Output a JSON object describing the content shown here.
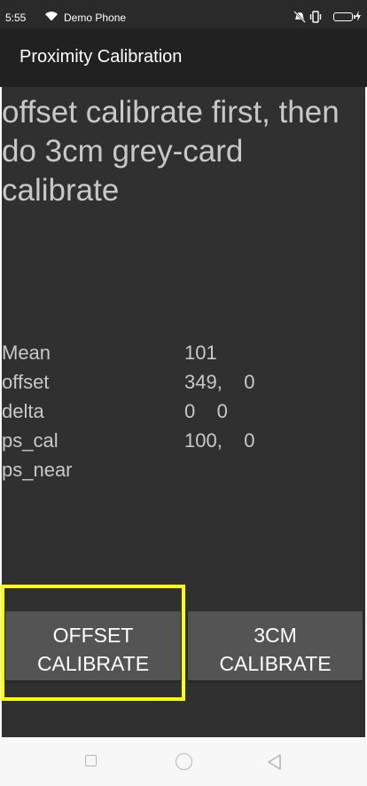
{
  "status_bar": {
    "time": "5:55",
    "carrier": "Demo Phone",
    "icons": [
      "wifi-icon",
      "mute-vibrate-icon",
      "vibrate-icon",
      "battery-icon",
      "charging-icon"
    ]
  },
  "app_bar": {
    "title": "Proximity Calibration"
  },
  "main": {
    "instruction": "offset calibrate first, then do 3cm grey-card calibrate",
    "stats": [
      {
        "label": "Mean",
        "value": "101"
      },
      {
        "label": "offset",
        "value": "349,    0"
      },
      {
        "label": "delta",
        "value": "0    0"
      },
      {
        "label": "ps_cal",
        "value": "100,    0"
      },
      {
        "label": "ps_near",
        "value": ""
      }
    ],
    "buttons": {
      "offset": {
        "line1": "OFFSET",
        "line2": "CALIBRATE"
      },
      "cm3": {
        "line1": "3CM",
        "line2": "CALIBRATE"
      }
    }
  },
  "nav_bar": {
    "icons": [
      "recents-square-icon",
      "home-circle-icon",
      "back-triangle-icon"
    ]
  },
  "colors": {
    "app_bar": "#212121",
    "content_bg": "#303030",
    "button_bg": "#545454",
    "highlight": "#ffff00"
  }
}
